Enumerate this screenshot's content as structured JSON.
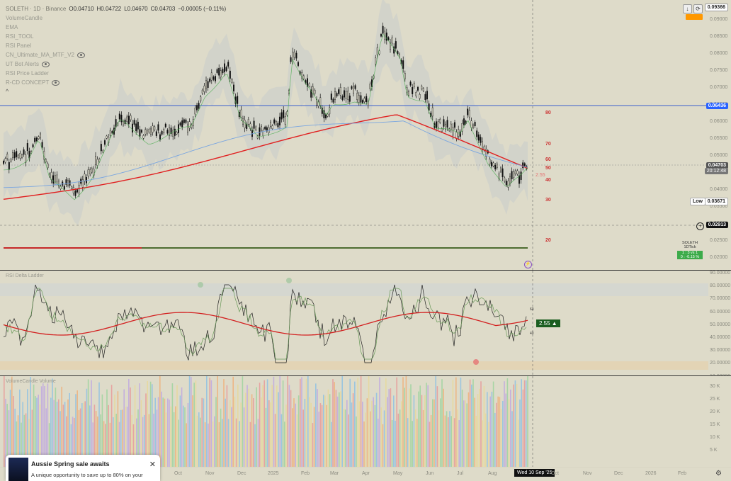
{
  "header": {
    "symbol": "SOLETH · 1D · Binance",
    "open": "O0.04710",
    "high": "H0.04722",
    "low": "L0.04670",
    "close": "C0.04703",
    "change": "−0.00005 (−0.11%)"
  },
  "indicators": [
    {
      "label": "VolumeCandle",
      "eye": false
    },
    {
      "label": "EMA",
      "eye": false
    },
    {
      "label": "RSI_TOOL",
      "eye": false
    },
    {
      "label": "RSI Panel",
      "eye": false
    },
    {
      "label": "CN_Ultimate_MA_MTF_V2",
      "eye": true
    },
    {
      "label": "UT Bot Alerts",
      "eye": true
    },
    {
      "label": "RSI Price Ladder",
      "eye": false
    },
    {
      "label": "R-CD CONCEPT",
      "eye": true
    }
  ],
  "price_axis": [
    "0.09000",
    "0.08500",
    "0.08000",
    "0.07500",
    "0.07000",
    "0.06500",
    "0.06000",
    "0.05500",
    "0.05000",
    "0.04500",
    "0.04000",
    "0.03500",
    "0.03000",
    "0.02500",
    "0.02000"
  ],
  "price_tags": {
    "top": "0.09366",
    "line": "0.06436",
    "last": "0.04703",
    "countdown": "20:12:48",
    "low_label": "Low",
    "low": "0.03671",
    "cursor": "0.02913"
  },
  "rsi_levels": [
    "80",
    "70",
    "60",
    "50",
    "40",
    "30",
    "20"
  ],
  "rsi_mini": "2.55",
  "info_box": {
    "title": "SOLETH",
    "tf": "1DTick",
    "r1": "1 : 3  vs  1",
    "r2": "0 : -0.15 %"
  },
  "rsi_pane": {
    "title": "RSI Delta Ladder",
    "axis": [
      "90.00000",
      "80.00000",
      "70.00000",
      "60.00000",
      "50.00000",
      "40.00000",
      "30.00000",
      "20.00000",
      "10.00000"
    ],
    "badge": "2.55 ▲",
    "l60": "60",
    "l40": "40"
  },
  "vol_pane": {
    "title": "VolumeCandle Volume",
    "axis": [
      "30 K",
      "25 K",
      "20 K",
      "15 K",
      "10 K",
      "5 K"
    ]
  },
  "dates": [
    "Oct",
    "Nov",
    "Dec",
    "2025",
    "Feb",
    "Mar",
    "Apr",
    "May",
    "Jun",
    "Jul",
    "Aug",
    "Oct",
    "Nov",
    "Dec",
    "2026",
    "Feb"
  ],
  "date_cursor": "Wed 10 Sep '25",
  "popup": {
    "title": "Aussie Spring sale awaits",
    "body": "A unique opportunity to save up to 80% on your"
  },
  "colors": {
    "ema_red": "#e02020",
    "ma_blue": "#7aa6e0",
    "band": "#c9cccb",
    "line_blue": "#3a5fcd"
  }
}
